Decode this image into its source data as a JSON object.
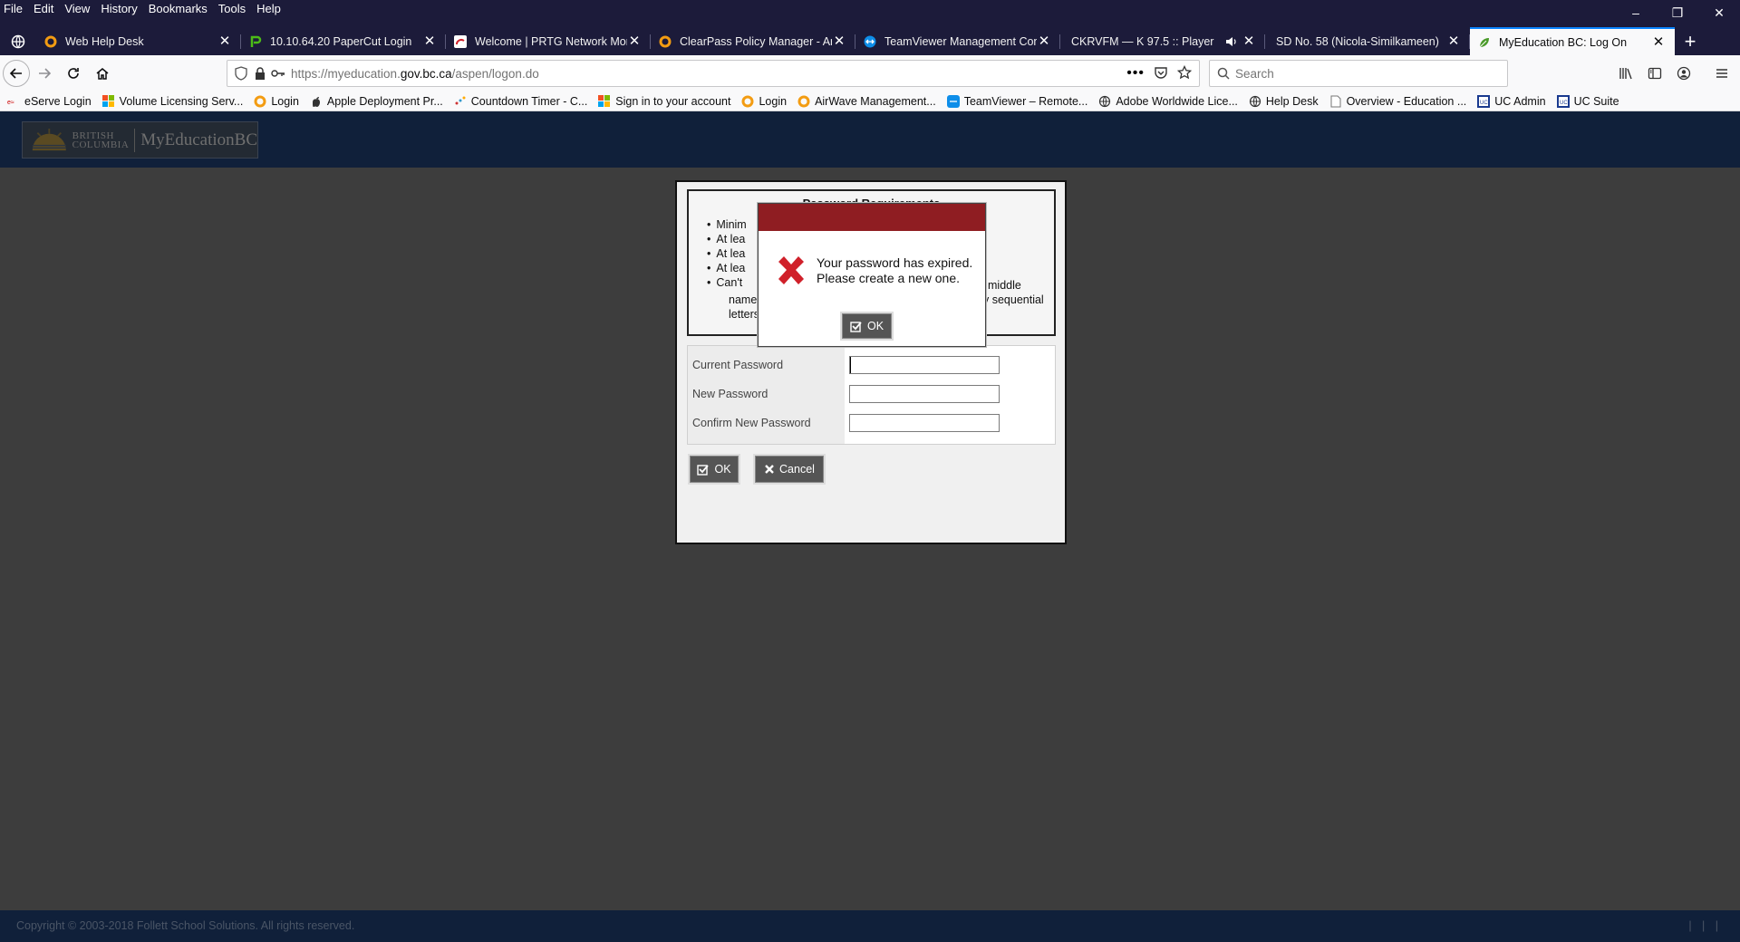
{
  "menu": [
    "File",
    "Edit",
    "View",
    "History",
    "Bookmarks",
    "Tools",
    "Help"
  ],
  "window_controls": {
    "minimize": "–",
    "restore": "❐",
    "close": "✕"
  },
  "tabs": [
    {
      "title": "Web Help Desk",
      "icon": "orange-ring-icon"
    },
    {
      "title": "10.10.64.20 PaperCut Login",
      "icon": "papercut-icon"
    },
    {
      "title": "Welcome | PRTG Network Moni",
      "icon": "prtg-icon"
    },
    {
      "title": "ClearPass Policy Manager - Aru",
      "icon": "orange-ring-icon"
    },
    {
      "title": "TeamViewer Management Con",
      "icon": "teamviewer-icon"
    },
    {
      "title": "CKRVFM — K 97.5 :: Player",
      "icon": "none"
    },
    {
      "title": "SD No. 58 (Nicola-Similkameen)",
      "icon": "none"
    },
    {
      "title": "MyEducation BC: Log On",
      "icon": "leaf-icon",
      "active": true
    }
  ],
  "url": {
    "prefix": "https://myeducation.",
    "domain": "gov.bc.ca",
    "path": "/aspen/logon.do"
  },
  "search": {
    "placeholder": "Search"
  },
  "bookmarks": [
    {
      "label": "eServe Login",
      "icon": "eserve-icon",
      "color": "#c00"
    },
    {
      "label": "Volume Licensing Serv...",
      "icon": "microsoft-icon",
      "color": "#f25022"
    },
    {
      "label": "Login",
      "icon": "orange-ring-icon",
      "color": "#f90"
    },
    {
      "label": "Apple Deployment Pr...",
      "icon": "apple-icon",
      "color": "#333"
    },
    {
      "label": "Countdown Timer - C...",
      "icon": "dots-icon",
      "color": "#c33"
    },
    {
      "label": "Sign in to your account",
      "icon": "microsoft-icon",
      "color": "#f25022"
    },
    {
      "label": "Login",
      "icon": "orange-ring-icon",
      "color": "#f90"
    },
    {
      "label": "AirWave Management...",
      "icon": "orange-ring-icon",
      "color": "#f90"
    },
    {
      "label": "TeamViewer – Remote...",
      "icon": "teamviewer-icon",
      "color": "#0e8ee9"
    },
    {
      "label": "Adobe Worldwide Lice...",
      "icon": "globe-icon",
      "color": "#333"
    },
    {
      "label": "Help Desk",
      "icon": "globe-icon",
      "color": "#333"
    },
    {
      "label": "Overview - Education ...",
      "icon": "page-icon",
      "color": "#888"
    },
    {
      "label": "UC Admin",
      "icon": "uc-icon",
      "color": "#1a3a8f"
    },
    {
      "label": "UC Suite",
      "icon": "uc-icon",
      "color": "#1a3a8f"
    }
  ],
  "site": {
    "logo_line1": "BRITISH",
    "logo_line2": "COLUMBIA",
    "logo_name": "MyEducationBC"
  },
  "requirements": {
    "title": "Password Requirements",
    "items": [
      "Minim",
      "At lea",
      "At lea",
      "At lea",
      "Can't"
    ],
    "line_name": "name",
    "line_letters": "letters",
    "right_middle": "middle",
    "right_sequential": "y sequential"
  },
  "form": {
    "current_label": "Current Password",
    "new_label": "New Password",
    "confirm_label": "Confirm New Password",
    "current_value": "",
    "new_value": "",
    "confirm_value": ""
  },
  "buttons": {
    "ok": "OK",
    "cancel": "Cancel"
  },
  "dialog": {
    "line1": "Your password has expired.",
    "line2": "Please create a new one.",
    "ok": "OK",
    "header_color": "#8f1d22"
  },
  "footer": {
    "copyright": "Copyright © 2003-2018 Follett School Solutions. All rights reserved.",
    "right": "| | |"
  }
}
